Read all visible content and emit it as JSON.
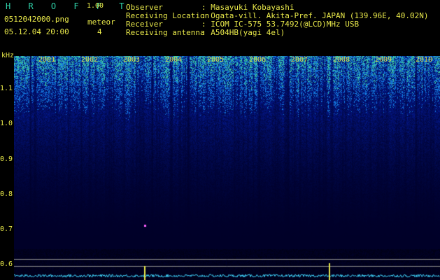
{
  "app": {
    "title": "H R O F F T",
    "version": "1.00"
  },
  "file": {
    "name": "0512042000.png",
    "datetime": "05.12.04 20:00"
  },
  "meteor": {
    "label": "meteor",
    "count": "4"
  },
  "info": [
    {
      "label": "Observer",
      "value": ": Masayuki Kobayashi"
    },
    {
      "label": "Receiving Location",
      "value": ": Ogata-vill. Akita-Pref. JAPAN (139.96E, 40.02N)"
    },
    {
      "label": "Receiver",
      "value": ": ICOM IC-575 53.7492(@LCD)MHz USB"
    },
    {
      "label": "Receiving antenna",
      "value": ": A504HB(yagi 4el)"
    }
  ],
  "axis": {
    "unit": "kHz",
    "y_ticks": [
      "1.1",
      "1.0",
      "0.9",
      "0.8",
      "0.7",
      "0.6"
    ],
    "years": [
      "2001",
      "2002",
      "2003",
      "2004",
      "2005",
      "2006",
      "2007",
      "2008",
      "2009",
      "2010"
    ]
  },
  "colors": {
    "title": "#2fd0a8",
    "text": "#e8e84a",
    "background": "#000000",
    "spectrum_low": "#000818",
    "spectrum_high": "#2a50c8"
  }
}
